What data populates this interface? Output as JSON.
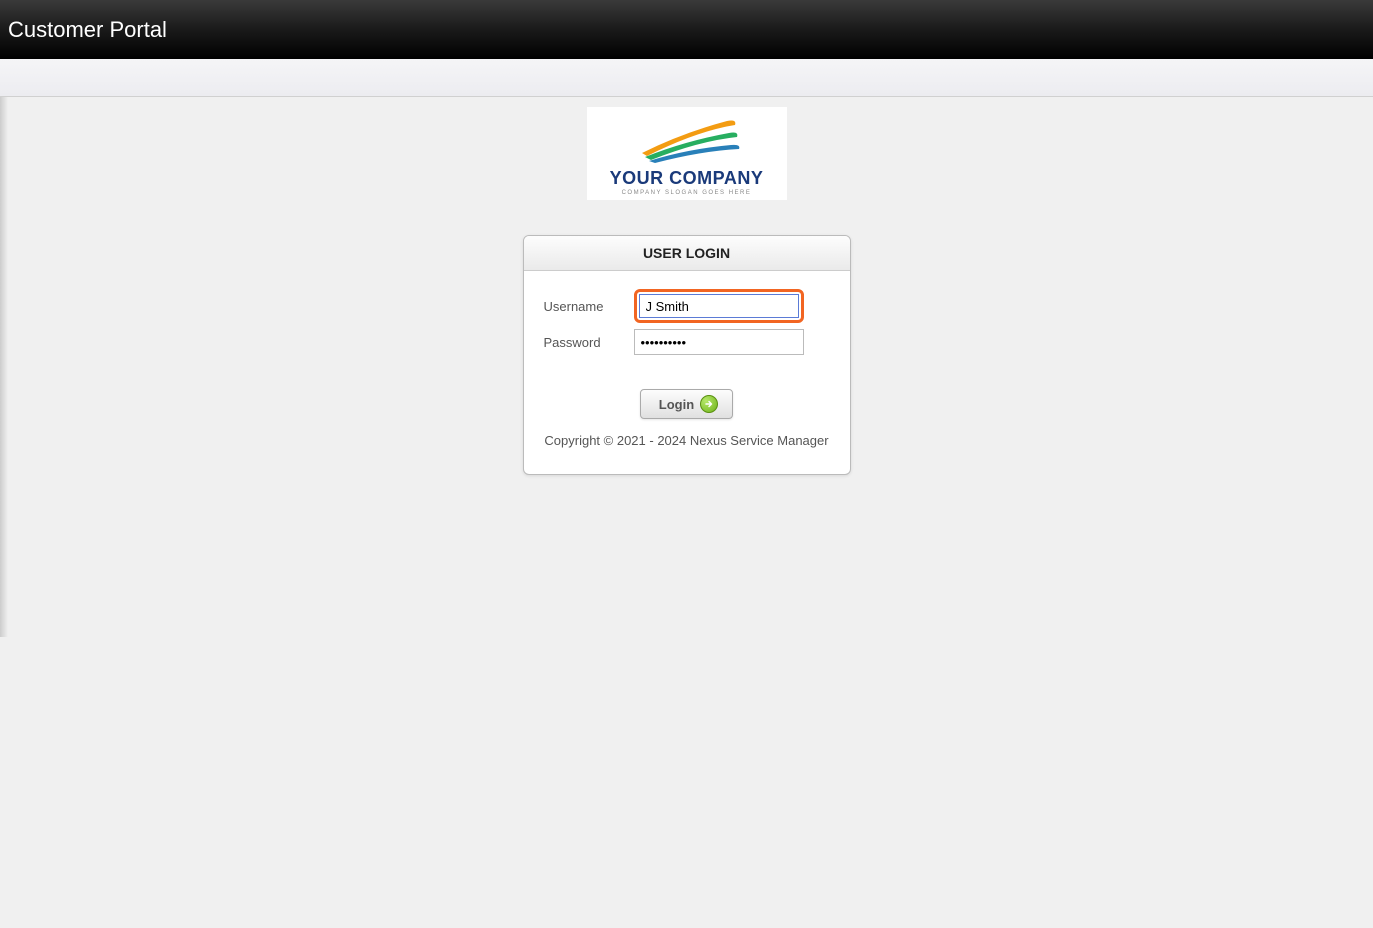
{
  "header": {
    "title": "Customer Portal"
  },
  "logo": {
    "company_name": "YOUR COMPANY",
    "tagline": "COMPANY SLOGAN GOES HERE"
  },
  "login_panel": {
    "title": "USER LOGIN",
    "username_label": "Username",
    "password_label": "Password",
    "username_value": "J Smith",
    "password_value": "••••••••••",
    "login_button_label": "Login"
  },
  "footer": {
    "copyright": "Copyright © 2021 - 2024 Nexus Service Manager"
  }
}
